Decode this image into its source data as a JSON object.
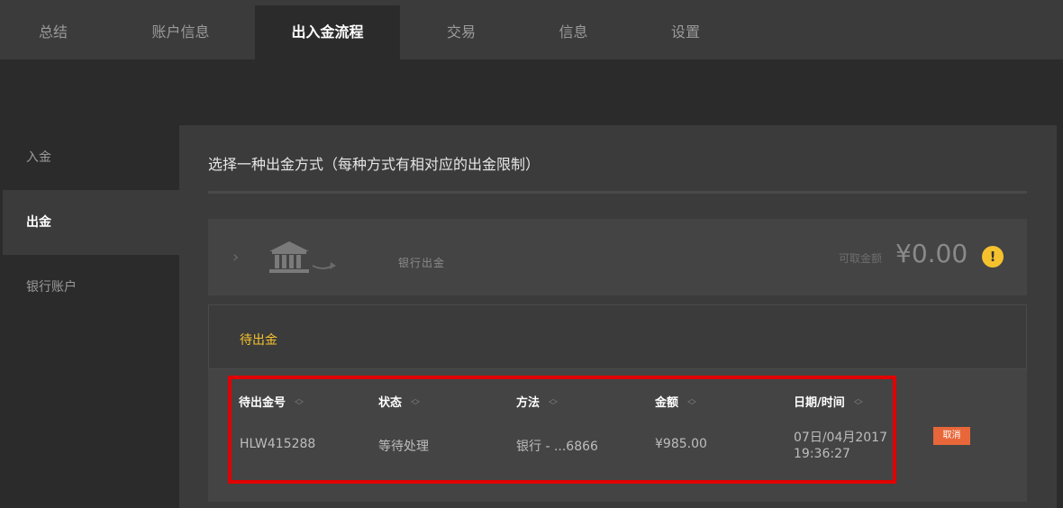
{
  "topnav": {
    "tabs": [
      {
        "label": "总结"
      },
      {
        "label": "账户信息"
      },
      {
        "label": "出入金流程"
      },
      {
        "label": "交易"
      },
      {
        "label": "信息"
      },
      {
        "label": "设置"
      }
    ],
    "active_index": 2
  },
  "sidebar": {
    "items": [
      {
        "label": "入金"
      },
      {
        "label": "出金"
      },
      {
        "label": "银行账户"
      }
    ],
    "active_index": 1
  },
  "main": {
    "title": "选择一种出金方式（每种方式有相对应的出金限制）",
    "method": {
      "label": "银行出金",
      "available_label": "可取金额",
      "available_amount": "¥0.00",
      "icon": "bank-icon",
      "warning_icon": "warning-icon"
    },
    "pending": {
      "title": "待出金",
      "columns": [
        "待出金号",
        "状态",
        "方法",
        "金额",
        "日期/时间"
      ],
      "rows": [
        {
          "id": "HLW415288",
          "status": "等待处理",
          "method": "银行 - ...6866",
          "amount": "¥985.00",
          "date": "07日/04月2017",
          "time": "19:36:27",
          "action": "取消"
        }
      ]
    }
  },
  "colors": {
    "accent": "#f5c22e",
    "cancel": "#e8673a",
    "highlight": "#e00000"
  }
}
